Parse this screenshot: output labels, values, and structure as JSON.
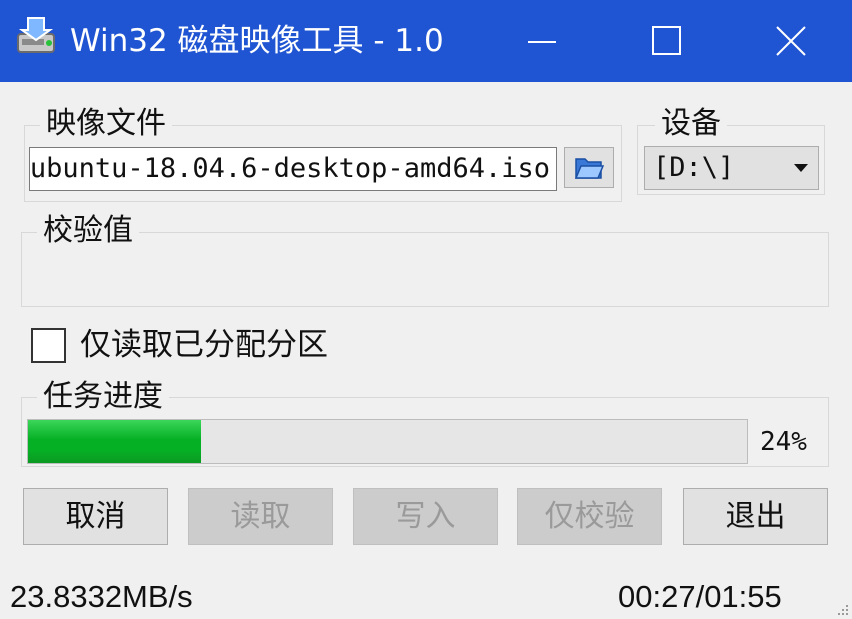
{
  "window": {
    "title": "Win32 磁盘映像工具 - 1.0",
    "titlebar_color": "#1f54d2"
  },
  "image_file": {
    "group_label": "映像文件",
    "path": "/ubuntu-18.04.6-desktop-amd64.iso"
  },
  "device": {
    "group_label": "设备",
    "selected": "[D:\\]"
  },
  "hash": {
    "group_label": "校验值"
  },
  "options": {
    "read_only_partitions_label": "仅读取已分配分区",
    "read_only_partitions_checked": false
  },
  "progress": {
    "group_label": "任务进度",
    "percent_text": "24%",
    "value": 0.24,
    "fill_color": "#06b025"
  },
  "buttons": {
    "cancel": "取消",
    "read": "读取",
    "write": "写入",
    "verify_only": "仅校验",
    "exit": "退出"
  },
  "status": {
    "speed": "23.8332MB/s",
    "time": "00:27/01:55"
  },
  "icons": [
    "app-disk-icon",
    "minimize-icon",
    "maximize-icon",
    "close-icon",
    "folder-open-icon",
    "dropdown-arrow-icon",
    "size-grip-icon"
  ]
}
